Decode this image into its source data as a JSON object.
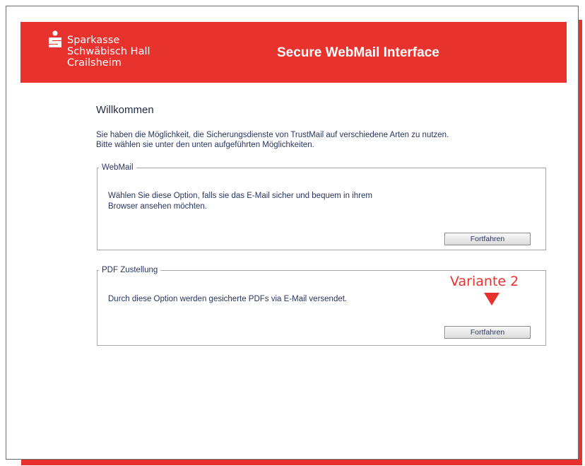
{
  "brand": {
    "name_lines": [
      "Sparkasse",
      "Schwäbisch Hall",
      "Crailsheim"
    ],
    "logo_icon": "sparkasse-s-icon",
    "color": "#e8322e"
  },
  "banner": {
    "title": "Secure WebMail Interface"
  },
  "main": {
    "heading": "Willkommen",
    "intro_lines": [
      "Sie haben die Möglichkeit, die Sicherungsdienste von TrustMail auf verschiedene Arten zu nutzen.",
      "Bitte wählen sie unter den unten aufgeführten Möglichkeiten."
    ]
  },
  "options": {
    "webmail": {
      "legend": "WebMail",
      "description_lines": [
        "Wählen Sie diese Option, falls sie das E-Mail sicher und bequem in ihrem",
        "Browser ansehen möchten."
      ],
      "button_label": "Fortfahren"
    },
    "pdf": {
      "legend": "PDF Zustellung",
      "description": "Durch diese Option werden gesicherte PDFs via E-Mail versendet.",
      "button_label": "Fortfahren"
    }
  },
  "annotation": {
    "label": "Variante 2",
    "color": "#e8322e",
    "arrow_icon": "arrow-down-icon"
  }
}
